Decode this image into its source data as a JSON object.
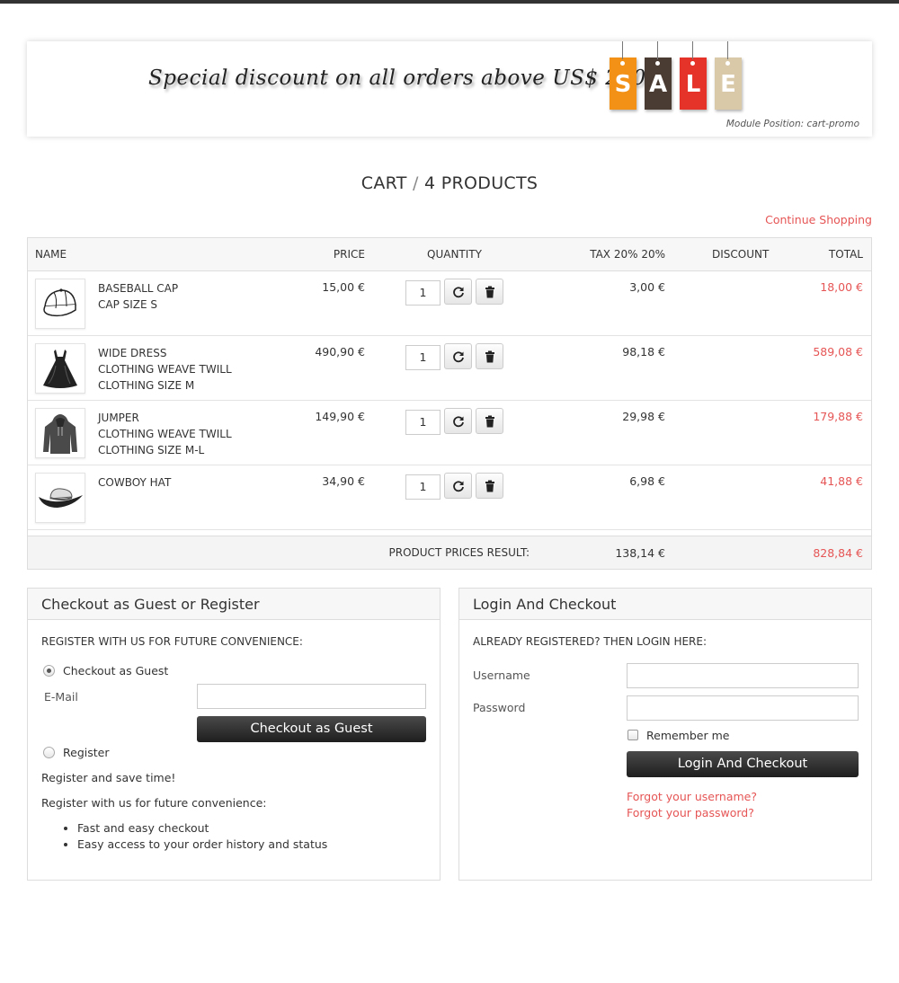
{
  "banner": {
    "text": "Special discount on all orders above US$ 250",
    "sale_letters": [
      "S",
      "A",
      "L",
      "E"
    ],
    "module_position": "Module Position: cart-promo"
  },
  "cart": {
    "title": "CART",
    "separator": "/",
    "count_label": "4 PRODUCTS",
    "continue_shopping": "Continue Shopping",
    "headers": {
      "name": "NAME",
      "price": "PRICE",
      "quantity": "QUANTITY",
      "tax": "TAX 20% 20%",
      "discount": "DISCOUNT",
      "total": "TOTAL"
    },
    "items": [
      {
        "name": "BASEBALL CAP",
        "attrs": [
          "CAP SIZE S",
          ""
        ],
        "price": "15,00 €",
        "qty": "1",
        "tax": "3,00 €",
        "total": "18,00 €",
        "image": "cap-icon"
      },
      {
        "name": "WIDE DRESS",
        "attrs": [
          "CLOTHING WEAVE TWILL",
          "CLOTHING SIZE M"
        ],
        "price": "490,90 €",
        "qty": "1",
        "tax": "98,18 €",
        "total": "589,08 €",
        "image": "dress-icon"
      },
      {
        "name": "JUMPER",
        "attrs": [
          "CLOTHING WEAVE TWILL",
          "CLOTHING SIZE M-L"
        ],
        "price": "149,90 €",
        "qty": "1",
        "tax": "29,98 €",
        "total": "179,88 €",
        "image": "jumper-icon"
      },
      {
        "name": "COWBOY HAT",
        "attrs": [
          "",
          ""
        ],
        "price": "34,90 €",
        "qty": "1",
        "tax": "6,98 €",
        "total": "41,88 €",
        "image": "hat-icon"
      }
    ],
    "footer": {
      "label": "PRODUCT PRICES RESULT:",
      "tax": "138,14 €",
      "total": "828,84 €"
    }
  },
  "guest_panel": {
    "title": "Checkout as Guest or Register",
    "subtitle": "REGISTER WITH US FOR FUTURE CONVENIENCE:",
    "option_guest": "Checkout as Guest",
    "email_label": "E-Mail",
    "email_value": "",
    "guest_button": "Checkout as Guest",
    "option_register": "Register",
    "line1": "Register and save time!",
    "line2": "Register with us for future convenience:",
    "bullets": [
      "Fast and easy checkout",
      "Easy access to your order history and status"
    ]
  },
  "login_panel": {
    "title": "Login And Checkout",
    "subtitle": "ALREADY REGISTERED? THEN LOGIN HERE:",
    "username_label": "Username",
    "username_value": "",
    "password_label": "Password",
    "password_value": "",
    "remember_label": "Remember me",
    "login_button": "Login And Checkout",
    "forgot_username": "Forgot your username?",
    "forgot_password": "Forgot your password?"
  },
  "colors": {
    "accent": "#e65555",
    "sale_tags": [
      "#f39016",
      "#4a3c33",
      "#e5332a",
      "#d9c9a8"
    ]
  }
}
